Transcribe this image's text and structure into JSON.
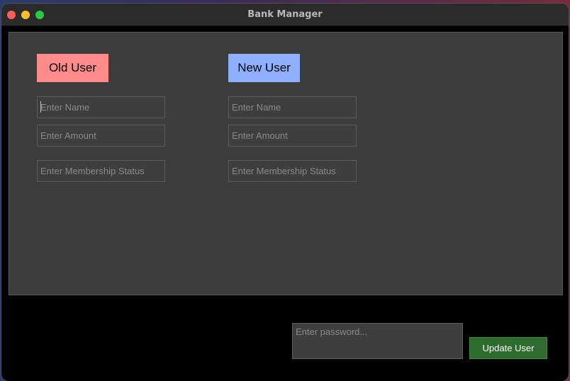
{
  "window": {
    "title": "Bank Manager"
  },
  "old_user": {
    "heading": "Old User",
    "heading_color": "#ff8b8b",
    "name_placeholder": "Enter Name",
    "amount_placeholder": "Enter Amount",
    "status_placeholder": "Enter Membership Status"
  },
  "new_user": {
    "heading": "New User",
    "heading_color": "#8fb0ff",
    "name_placeholder": "Enter Name",
    "amount_placeholder": "Enter Amount",
    "status_placeholder": "Enter Membership Status"
  },
  "footer": {
    "password_placeholder": "Enter password...",
    "update_button": "Update User",
    "update_button_color": "#2e6b2e"
  },
  "icons": {
    "close": "close-traffic-light-icon",
    "minimize": "minimize-traffic-light-icon",
    "maximize": "maximize-traffic-light-icon"
  }
}
